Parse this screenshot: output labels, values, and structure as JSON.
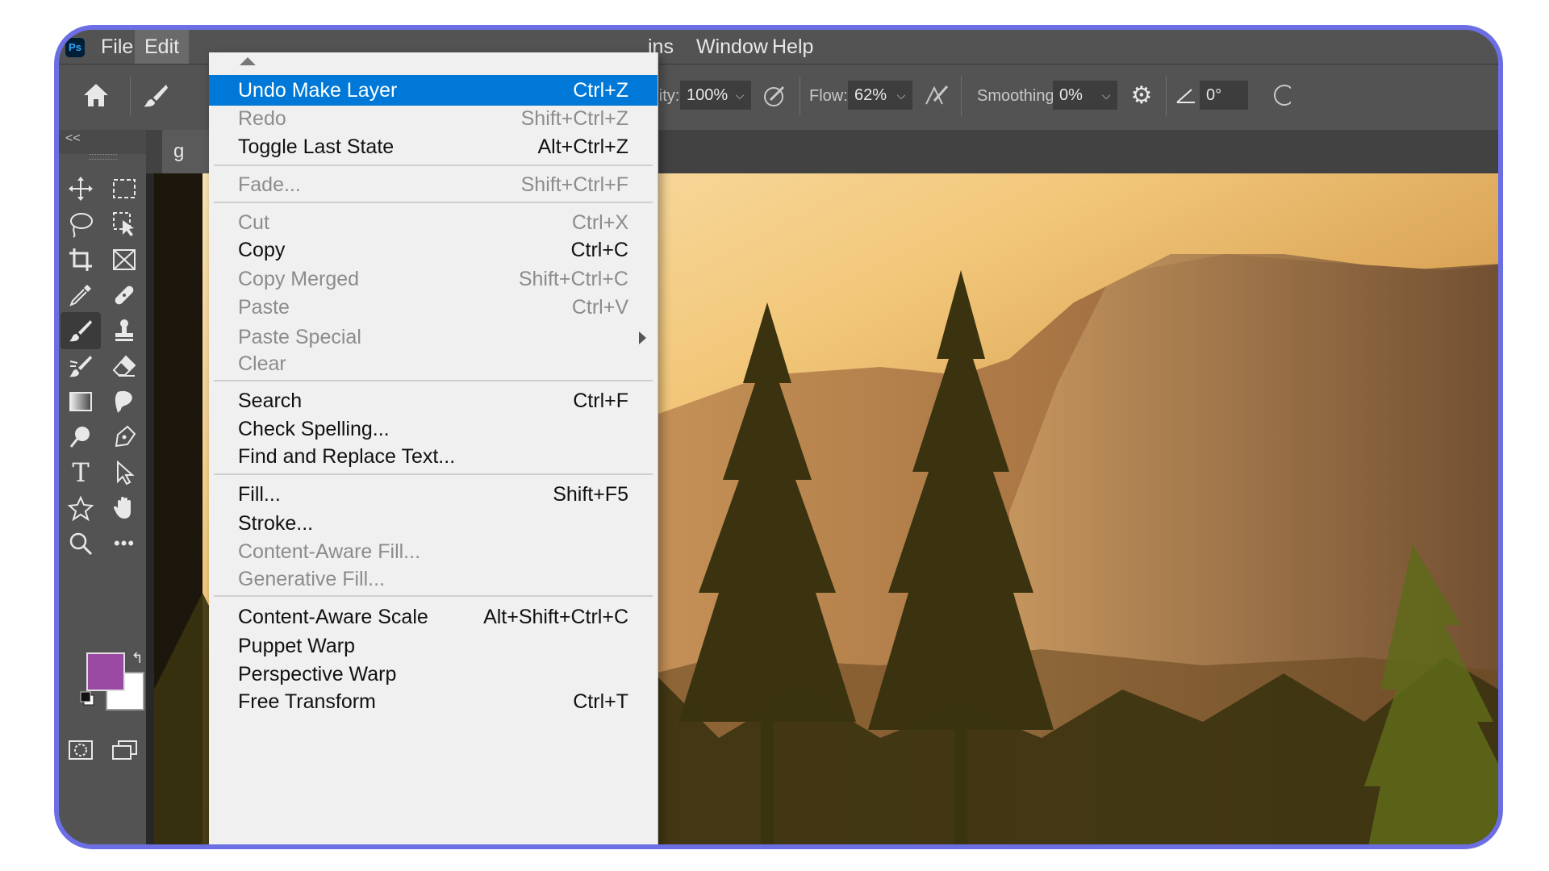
{
  "app": {
    "logo_text": "Ps"
  },
  "menubar": {
    "items": [
      "File",
      "Edit",
      "ins",
      "Window",
      "Help"
    ],
    "active_item": "Edit"
  },
  "options_bar": {
    "opacity_label": "Opacity:",
    "opacity_value": "100%",
    "flow_label": "Flow:",
    "flow_value": "62%",
    "smoothing_label": "Smoothing:",
    "smoothing_value": "0%",
    "angle_value": "0°"
  },
  "toolbar": {
    "collapse_label": "<<",
    "tools": [
      {
        "name": "move-tool-icon",
        "glyph": "✥"
      },
      {
        "name": "marquee-tool-icon",
        "glyph": "⬚"
      },
      {
        "name": "lasso-tool-icon",
        "glyph": "◯"
      },
      {
        "name": "object-selection-tool-icon",
        "glyph": "⬚"
      },
      {
        "name": "crop-tool-icon",
        "glyph": "⌗"
      },
      {
        "name": "frame-tool-icon",
        "glyph": "⊠"
      },
      {
        "name": "eyedropper-tool-icon",
        "glyph": "✎"
      },
      {
        "name": "healing-brush-tool-icon",
        "glyph": "✚"
      },
      {
        "name": "brush-tool-icon",
        "glyph": "✎"
      },
      {
        "name": "clone-stamp-tool-icon",
        "glyph": "⏚"
      },
      {
        "name": "history-brush-tool-icon",
        "glyph": "✐"
      },
      {
        "name": "eraser-tool-icon",
        "glyph": "◇"
      },
      {
        "name": "gradient-tool-icon",
        "glyph": "▭"
      },
      {
        "name": "blur-tool-icon",
        "glyph": "❦"
      },
      {
        "name": "dodge-tool-icon",
        "glyph": "●"
      },
      {
        "name": "pen-tool-icon",
        "glyph": "✒"
      },
      {
        "name": "type-tool-icon",
        "glyph": "T"
      },
      {
        "name": "path-selection-tool-icon",
        "glyph": "➤"
      },
      {
        "name": "shape-tool-icon",
        "glyph": "✩"
      },
      {
        "name": "hand-tool-icon",
        "glyph": "✋"
      },
      {
        "name": "zoom-tool-icon",
        "glyph": "⚲"
      },
      {
        "name": "more-tools-icon",
        "glyph": "•••"
      }
    ],
    "foreground_color": "#9a4aa3",
    "background_color": "#ffffff"
  },
  "document": {
    "tab_label": "g"
  },
  "edit_menu": {
    "items": [
      {
        "label": "Undo Make Layer",
        "shortcut": "Ctrl+Z",
        "state": "highlight"
      },
      {
        "label": "Redo",
        "shortcut": "Shift+Ctrl+Z",
        "state": "disabled"
      },
      {
        "label": "Toggle Last State",
        "shortcut": "Alt+Ctrl+Z",
        "state": "enabled"
      },
      {
        "label": "Fade...",
        "shortcut": "Shift+Ctrl+F",
        "state": "disabled"
      },
      {
        "label": "Cut",
        "shortcut": "Ctrl+X",
        "state": "disabled"
      },
      {
        "label": "Copy",
        "shortcut": "Ctrl+C",
        "state": "enabled"
      },
      {
        "label": "Copy Merged",
        "shortcut": "Shift+Ctrl+C",
        "state": "disabled"
      },
      {
        "label": "Paste",
        "shortcut": "Ctrl+V",
        "state": "disabled"
      },
      {
        "label": "Paste Special",
        "shortcut": "",
        "state": "disabled"
      },
      {
        "label": "Clear",
        "shortcut": "",
        "state": "disabled"
      },
      {
        "label": "Search",
        "shortcut": "Ctrl+F",
        "state": "enabled"
      },
      {
        "label": "Check Spelling...",
        "shortcut": "",
        "state": "enabled"
      },
      {
        "label": "Find and Replace Text...",
        "shortcut": "",
        "state": "enabled"
      },
      {
        "label": "Fill...",
        "shortcut": "Shift+F5",
        "state": "enabled"
      },
      {
        "label": "Stroke...",
        "shortcut": "",
        "state": "enabled"
      },
      {
        "label": "Content-Aware Fill...",
        "shortcut": "",
        "state": "disabled"
      },
      {
        "label": "Generative Fill...",
        "shortcut": "",
        "state": "disabled"
      },
      {
        "label": "Content-Aware Scale",
        "shortcut": "Alt+Shift+Ctrl+C",
        "state": "enabled"
      },
      {
        "label": "Puppet Warp",
        "shortcut": "",
        "state": "enabled"
      },
      {
        "label": "Perspective Warp",
        "shortcut": "",
        "state": "enabled"
      },
      {
        "label": "Free Transform",
        "shortcut": "Ctrl+T",
        "state": "enabled"
      }
    ]
  },
  "colors": {
    "frame_border": "#6b6fe3",
    "menu_highlight": "#0078d7",
    "panel_bg": "#535353"
  }
}
